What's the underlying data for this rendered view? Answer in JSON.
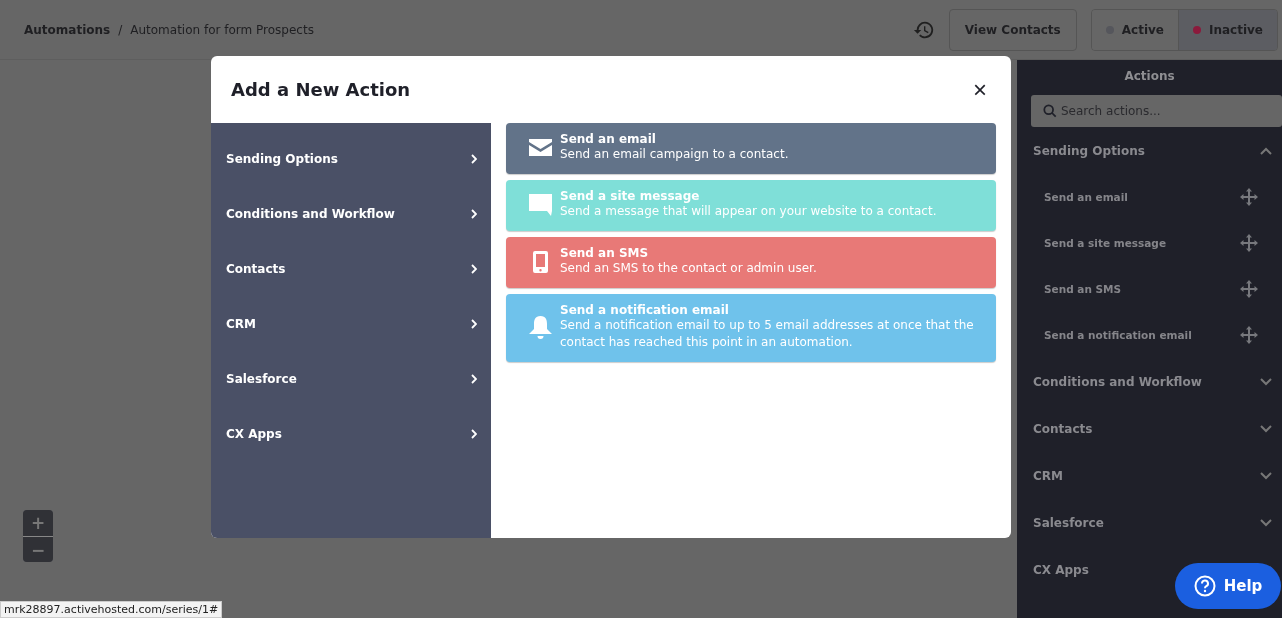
{
  "header": {
    "breadcrumb": [
      {
        "label": "Automations"
      },
      {
        "label": "/"
      },
      {
        "label": "Automation for form Prospects"
      }
    ],
    "view_contacts": "View Contacts",
    "status": [
      {
        "label": "Active",
        "selected": false,
        "color": "#55565c"
      },
      {
        "label": "Inactive",
        "selected": true,
        "color": "#8b1a3c"
      }
    ]
  },
  "canvas": {
    "zoom_in": "+",
    "zoom_out": "−"
  },
  "modal": {
    "title": "Add a New Action",
    "close": "×",
    "categories": [
      {
        "label": "Sending Options"
      },
      {
        "label": "Conditions and Workflow"
      },
      {
        "label": "Contacts"
      },
      {
        "label": "CRM"
      },
      {
        "label": "Salesforce"
      },
      {
        "label": "CX Apps"
      }
    ],
    "actions": [
      {
        "kind": "email",
        "color": "#627389",
        "title": "Send an email",
        "description": "Send an email campaign to a contact."
      },
      {
        "kind": "message",
        "color": "#7fdfd8",
        "title": "Send a site message",
        "description": "Send a message that will appear on your website to a contact."
      },
      {
        "kind": "sms",
        "color": "#e87977",
        "title": "Send an SMS",
        "description": "Send an SMS to the contact or admin user."
      },
      {
        "kind": "notification",
        "color": "#6fc2eb",
        "title": "Send a notification email",
        "description": "Send a notification email to up to 5 email addresses at once that the contact has reached this point in an automation."
      }
    ]
  },
  "sidebar": {
    "title": "Actions",
    "search": {
      "placeholder": "Search actions..."
    },
    "sections": [
      {
        "label": "Sending Options",
        "expanded": true,
        "children": [
          {
            "label": "Send an email"
          },
          {
            "label": "Send a site message"
          },
          {
            "label": "Send an SMS"
          },
          {
            "label": "Send a notification email"
          }
        ]
      },
      {
        "label": "Conditions and Workflow",
        "expanded": false
      },
      {
        "label": "Contacts",
        "expanded": false
      },
      {
        "label": "CRM",
        "expanded": false
      },
      {
        "label": "Salesforce",
        "expanded": false
      },
      {
        "label": "CX Apps",
        "expanded": false
      }
    ]
  },
  "help": "Help",
  "status_url": "mrk28897.activehosted.com/series/1#"
}
